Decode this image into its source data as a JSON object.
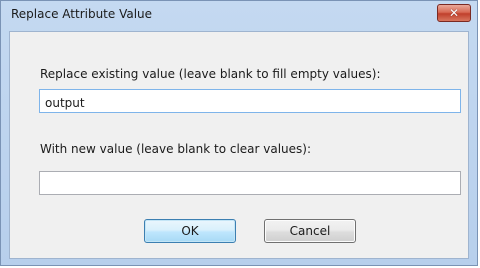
{
  "window": {
    "title": "Replace Attribute Value",
    "close_glyph": "✕"
  },
  "form": {
    "existing_label": "Replace existing value  (leave blank to fill empty values):",
    "existing_value": "output",
    "new_label": "With new value  (leave blank to clear values):",
    "new_value": ""
  },
  "buttons": {
    "ok_label": "OK",
    "cancel_label": "Cancel"
  },
  "colors": {
    "frame": "#c4d9f1",
    "close_button": "#c74a35",
    "ok_border": "#3c7fb1",
    "focus_border": "#7eb4ea"
  }
}
